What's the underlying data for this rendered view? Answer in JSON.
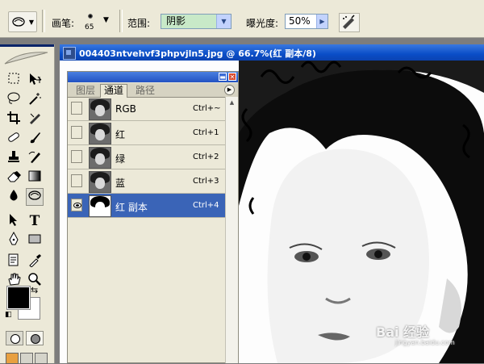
{
  "options_bar": {
    "brush_label": "画笔:",
    "brush_size": "65",
    "range_label": "范围:",
    "range_value": "阴影",
    "exposure_label": "曝光度:",
    "exposure_value": "50%"
  },
  "document": {
    "title": "004403ntvehvf3phpvjln5.jpg @ 66.7%(红 副本/8)"
  },
  "channels_panel": {
    "tabs": [
      "图层",
      "通道",
      "路径"
    ],
    "active_tab": "通道",
    "channels": [
      {
        "name": "RGB",
        "shortcut": "Ctrl+~",
        "visible": false,
        "selected": false
      },
      {
        "name": "红",
        "shortcut": "Ctrl+1",
        "visible": false,
        "selected": false
      },
      {
        "name": "绿",
        "shortcut": "Ctrl+2",
        "visible": false,
        "selected": false
      },
      {
        "name": "蓝",
        "shortcut": "Ctrl+3",
        "visible": false,
        "selected": false
      },
      {
        "name": "红 副本",
        "shortcut": "Ctrl+4",
        "visible": true,
        "selected": true
      }
    ]
  },
  "toolbox": {
    "selected_tool": "dodge-tool",
    "foreground_color": "#000000",
    "background_color": "#ffffff"
  },
  "colors": {
    "title_bar_blue": "#0a4ec8",
    "selected_row": "#3a64b7",
    "panel_bg": "#ece9d8"
  },
  "watermark": {
    "text": "Bai 经验",
    "sub": "jingyan.baidu.com"
  }
}
